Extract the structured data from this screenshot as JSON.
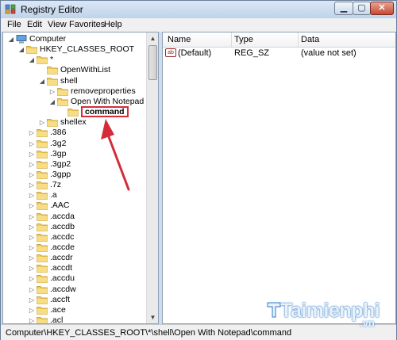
{
  "window": {
    "title": "Registry Editor"
  },
  "menu": [
    "File",
    "Edit",
    "View",
    "Favorites",
    "Help"
  ],
  "tree": [
    {
      "label": "Computer",
      "depth": 0,
      "expander": "open",
      "icon": "computer-icon"
    },
    {
      "label": "HKEY_CLASSES_ROOT",
      "depth": 1,
      "expander": "open",
      "icon": "folder-icon"
    },
    {
      "label": "*",
      "depth": 2,
      "expander": "open",
      "icon": "folder-icon"
    },
    {
      "label": "OpenWithList",
      "depth": 3,
      "expander": "none",
      "icon": "folder-icon"
    },
    {
      "label": "shell",
      "depth": 3,
      "expander": "open",
      "icon": "folder-icon"
    },
    {
      "label": "removeproperties",
      "depth": 4,
      "expander": "closed",
      "icon": "folder-icon"
    },
    {
      "label": "Open With Notepad",
      "depth": 4,
      "expander": "open",
      "icon": "folder-icon"
    },
    {
      "label": "command",
      "depth": 5,
      "expander": "none",
      "icon": "folder-icon",
      "selected": true
    },
    {
      "label": "shellex",
      "depth": 3,
      "expander": "closed",
      "icon": "folder-icon"
    },
    {
      "label": ".386",
      "depth": 2,
      "expander": "closed",
      "icon": "folder-icon"
    },
    {
      "label": ".3g2",
      "depth": 2,
      "expander": "closed",
      "icon": "folder-icon"
    },
    {
      "label": ".3gp",
      "depth": 2,
      "expander": "closed",
      "icon": "folder-icon"
    },
    {
      "label": ".3gp2",
      "depth": 2,
      "expander": "closed",
      "icon": "folder-icon"
    },
    {
      "label": ".3gpp",
      "depth": 2,
      "expander": "closed",
      "icon": "folder-icon"
    },
    {
      "label": ".7z",
      "depth": 2,
      "expander": "closed",
      "icon": "folder-icon"
    },
    {
      "label": ".a",
      "depth": 2,
      "expander": "closed",
      "icon": "folder-icon"
    },
    {
      "label": ".AAC",
      "depth": 2,
      "expander": "closed",
      "icon": "folder-icon"
    },
    {
      "label": ".accda",
      "depth": 2,
      "expander": "closed",
      "icon": "folder-icon"
    },
    {
      "label": ".accdb",
      "depth": 2,
      "expander": "closed",
      "icon": "folder-icon"
    },
    {
      "label": ".accdc",
      "depth": 2,
      "expander": "closed",
      "icon": "folder-icon"
    },
    {
      "label": ".accde",
      "depth": 2,
      "expander": "closed",
      "icon": "folder-icon"
    },
    {
      "label": ".accdr",
      "depth": 2,
      "expander": "closed",
      "icon": "folder-icon"
    },
    {
      "label": ".accdt",
      "depth": 2,
      "expander": "closed",
      "icon": "folder-icon"
    },
    {
      "label": ".accdu",
      "depth": 2,
      "expander": "closed",
      "icon": "folder-icon"
    },
    {
      "label": ".accdw",
      "depth": 2,
      "expander": "closed",
      "icon": "folder-icon"
    },
    {
      "label": ".accft",
      "depth": 2,
      "expander": "closed",
      "icon": "folder-icon"
    },
    {
      "label": ".ace",
      "depth": 2,
      "expander": "closed",
      "icon": "folder-icon"
    },
    {
      "label": ".acl",
      "depth": 2,
      "expander": "closed",
      "icon": "folder-icon"
    }
  ],
  "list": {
    "columns": [
      "Name",
      "Type",
      "Data"
    ],
    "rows": [
      {
        "name": "(Default)",
        "type": "REG_SZ",
        "data": "(value not set)",
        "icon": "string-value-icon"
      }
    ]
  },
  "status": {
    "path": "Computer\\HKEY_CLASSES_ROOT\\*\\shell\\Open With Notepad\\command"
  },
  "watermark": {
    "brand": "Taimienphi",
    "tld": ".vn"
  },
  "colors": {
    "annotation_red": "#d42d39",
    "folder_yellow": "#f2cc5a",
    "window_frame": "#cddcee",
    "watermark_blue": "#2a79c9"
  }
}
